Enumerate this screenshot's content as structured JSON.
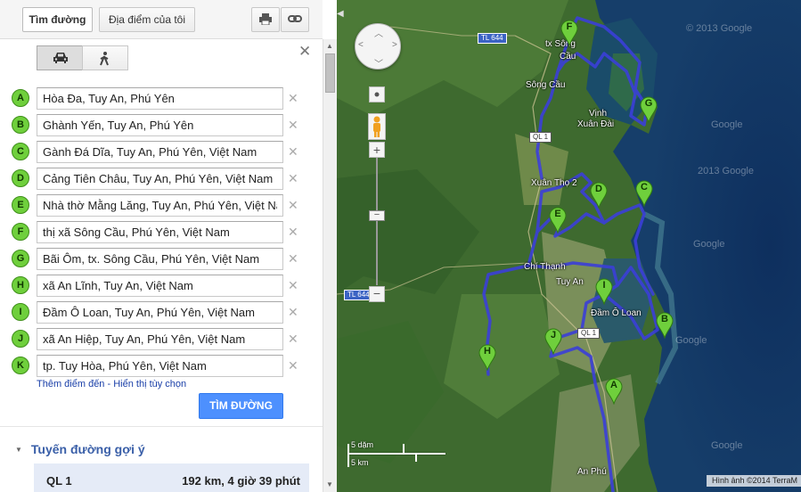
{
  "toolbar": {
    "directions_label": "Tìm đường",
    "myplaces_label": "Địa điểm của tôi"
  },
  "waypoints": [
    {
      "letter": "A",
      "value": "Hòa Đa, Tuy An, Phú Yên"
    },
    {
      "letter": "B",
      "value": "Ghành Yến, Tuy An, Phú Yên"
    },
    {
      "letter": "C",
      "value": "Gành Đá Dĩa, Tuy An, Phú Yên, Việt Nam"
    },
    {
      "letter": "D",
      "value": "Cảng Tiên Châu, Tuy An, Phú Yên, Việt Nam"
    },
    {
      "letter": "E",
      "value": "Nhà thờ Mằng Lăng, Tuy An, Phú Yên, Việt Nam"
    },
    {
      "letter": "F",
      "value": "thị xã Sông Cầu, Phú Yên, Việt Nam"
    },
    {
      "letter": "G",
      "value": "Bãi Ôm, tx. Sông Cầu, Phú Yên, Việt Nam"
    },
    {
      "letter": "H",
      "value": "xã An Lĩnh, Tuy An, Việt Nam"
    },
    {
      "letter": "I",
      "value": "Đầm Ô Loan, Tuy An, Phú Yên, Việt Nam"
    },
    {
      "letter": "J",
      "value": "xã An Hiệp, Tuy An, Phú Yên, Việt Nam"
    },
    {
      "letter": "K",
      "value": "tp. Tuy Hòa, Phú Yên, Việt Nam"
    }
  ],
  "links": {
    "add_destination": "Thêm điểm đến",
    "separator": " - ",
    "show_options": "Hiển thị tùy chọn"
  },
  "search_button": "TÌM ĐƯỜNG",
  "suggested": {
    "heading": "Tuyến đường gợi ý",
    "route_name": "QL 1",
    "route_info": "192 km, 4 giờ 39 phút"
  },
  "map": {
    "labels": {
      "tx_song_cau_1": "tx Sông",
      "tx_song_cau_2": "Cầu",
      "song_cau": "Sông Cầu",
      "vinh": "Vịnh",
      "xuan_dai": "Xuân Đài",
      "xuan_tho": "Xuân Thọ 2",
      "chi_thanh": "Chí Thạnh",
      "tuy_an": "Tuy An",
      "dam_o_loan": "Đầm Ô Loan",
      "an_phu": "An Phú"
    },
    "shields": {
      "tl644_top": "TL 644",
      "ql1_a": "QL 1",
      "tl644_left": "TL 644",
      "ql1_b": "QL 1"
    },
    "watermarks": {
      "w1": "© 2013 Google",
      "w2": "2013 Google",
      "w3": "Google",
      "w4": "Google",
      "w5": "Google",
      "w6": "Google"
    },
    "scale_imperial": "5 dặm",
    "scale_metric": "5 km",
    "attribution": "Hình ảnh ©2014 TerraM",
    "pins": [
      {
        "letter": "F"
      },
      {
        "letter": "G"
      },
      {
        "letter": "D"
      },
      {
        "letter": "C"
      },
      {
        "letter": "E"
      },
      {
        "letter": "I"
      },
      {
        "letter": "B"
      },
      {
        "letter": "J"
      },
      {
        "letter": "H"
      },
      {
        "letter": "A"
      }
    ]
  },
  "colors": {
    "route": "#3b3fd8",
    "marker": "#6fcf3c",
    "button": "#4d90fe"
  }
}
